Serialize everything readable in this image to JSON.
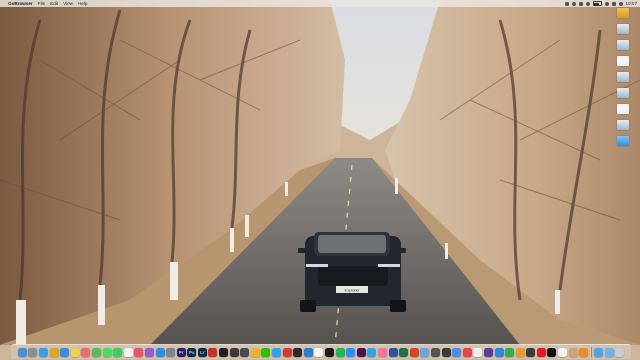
{
  "menubar": {
    "app_name": "GoBrowser",
    "menus": [
      "File",
      "Edit",
      "View",
      "Help"
    ],
    "clock": "10:07"
  },
  "desktop_icons": [
    {
      "name": "folder",
      "icon": "folder-icon",
      "label": ""
    },
    {
      "name": "screenshot",
      "icon": "screenshot-icon",
      "label": ""
    },
    {
      "name": "screenshot-2",
      "icon": "screenshot-icon",
      "label": ""
    },
    {
      "name": "document",
      "icon": "document-icon",
      "label": ""
    },
    {
      "name": "screenshot-3",
      "icon": "screenshot-icon",
      "label": ""
    },
    {
      "name": "screenshot-4",
      "icon": "screenshot-icon",
      "label": ""
    },
    {
      "name": "document-2",
      "icon": "document-icon",
      "label": ""
    },
    {
      "name": "screenshot-5",
      "icon": "screenshot-icon",
      "label": ""
    },
    {
      "name": "folder-blue",
      "icon": "folder-blue-icon",
      "label": ""
    }
  ],
  "dock": {
    "items": [
      {
        "name": "finder",
        "color": "#4a90d9",
        "glyph": ""
      },
      {
        "name": "launchpad",
        "color": "#8a8f98",
        "glyph": ""
      },
      {
        "name": "safari",
        "color": "#3aa0e8",
        "glyph": ""
      },
      {
        "name": "chrome",
        "color": "#e2a422",
        "glyph": ""
      },
      {
        "name": "mail",
        "color": "#3b8be0",
        "glyph": ""
      },
      {
        "name": "notes",
        "color": "#f2d04a",
        "glyph": ""
      },
      {
        "name": "photos",
        "color": "#e96d6d",
        "glyph": ""
      },
      {
        "name": "maps",
        "color": "#5bb85d",
        "glyph": ""
      },
      {
        "name": "messages",
        "color": "#4cd964",
        "glyph": ""
      },
      {
        "name": "facetime",
        "color": "#3ccf5b",
        "glyph": ""
      },
      {
        "name": "calendar",
        "color": "#f4f4f4",
        "glyph": ""
      },
      {
        "name": "music",
        "color": "#f0506e",
        "glyph": ""
      },
      {
        "name": "podcasts",
        "color": "#9b59d0",
        "glyph": ""
      },
      {
        "name": "app-store",
        "color": "#2f8ee8",
        "glyph": ""
      },
      {
        "name": "system-settings",
        "color": "#7d8691",
        "glyph": ""
      },
      {
        "name": "premiere",
        "color": "#2a1f5c",
        "glyph": "Pr"
      },
      {
        "name": "photoshop",
        "color": "#0c2b48",
        "glyph": "Ps"
      },
      {
        "name": "lightroom",
        "color": "#0f2a44",
        "glyph": "Lr"
      },
      {
        "name": "acrobat",
        "color": "#c8302a",
        "glyph": ""
      },
      {
        "name": "terminal",
        "color": "#1f1f1f",
        "glyph": ""
      },
      {
        "name": "final-cut",
        "color": "#3a3a3a",
        "glyph": ""
      },
      {
        "name": "davinci",
        "color": "#4a4a55",
        "glyph": ""
      },
      {
        "name": "sketch",
        "color": "#f5b02a",
        "glyph": ""
      },
      {
        "name": "wechat",
        "color": "#2dc100",
        "glyph": ""
      },
      {
        "name": "qq",
        "color": "#2aa4f4",
        "glyph": ""
      },
      {
        "name": "netease-music",
        "color": "#d33a31",
        "glyph": ""
      },
      {
        "name": "obs",
        "color": "#2b2b2b",
        "glyph": ""
      },
      {
        "name": "vscode",
        "color": "#2a7fd4",
        "glyph": ""
      },
      {
        "name": "notion",
        "color": "#f7f7f7",
        "glyph": ""
      },
      {
        "name": "figma",
        "color": "#1e1e1e",
        "glyph": ""
      },
      {
        "name": "spotify",
        "color": "#1db954",
        "glyph": ""
      },
      {
        "name": "zoom",
        "color": "#2d8cff",
        "glyph": ""
      },
      {
        "name": "slack",
        "color": "#4a154b",
        "glyph": ""
      },
      {
        "name": "telegram",
        "color": "#2ca5e0",
        "glyph": ""
      },
      {
        "name": "bilibili",
        "color": "#fb7299",
        "glyph": ""
      },
      {
        "name": "word",
        "color": "#2b579a",
        "glyph": ""
      },
      {
        "name": "excel",
        "color": "#217346",
        "glyph": ""
      },
      {
        "name": "powerpoint",
        "color": "#d24726",
        "glyph": ""
      },
      {
        "name": "preview",
        "color": "#6aa8e0",
        "glyph": ""
      },
      {
        "name": "calculator",
        "color": "#555555",
        "glyph": ""
      },
      {
        "name": "activity-monitor",
        "color": "#3a3a3a",
        "glyph": ""
      },
      {
        "name": "baidu-netdisk",
        "color": "#4a8ef0",
        "glyph": ""
      },
      {
        "name": "xmind",
        "color": "#e8424a",
        "glyph": ""
      },
      {
        "name": "typora",
        "color": "#efefef",
        "glyph": ""
      },
      {
        "name": "iina",
        "color": "#5a3f9e",
        "glyph": ""
      },
      {
        "name": "keynote",
        "color": "#2d88e0",
        "glyph": ""
      },
      {
        "name": "numbers",
        "color": "#30b04b",
        "glyph": ""
      },
      {
        "name": "pages",
        "color": "#f09a2a",
        "glyph": ""
      },
      {
        "name": "quicktime",
        "color": "#3b3b3b",
        "glyph": ""
      },
      {
        "name": "weibo",
        "color": "#e6162d",
        "glyph": ""
      },
      {
        "name": "douyin",
        "color": "#111111",
        "glyph": ""
      },
      {
        "name": "reminders",
        "color": "#f2f2f2",
        "glyph": ""
      },
      {
        "name": "contacts",
        "color": "#c9a577",
        "glyph": ""
      },
      {
        "name": "books",
        "color": "#f08a24",
        "glyph": ""
      }
    ],
    "trailing": [
      {
        "name": "downloads-folder",
        "color": "#4fa3e8",
        "glyph": ""
      },
      {
        "name": "documents-folder",
        "color": "#6cb4ee",
        "glyph": ""
      },
      {
        "name": "trash",
        "color": "#c9cdd2",
        "glyph": ""
      }
    ]
  },
  "wallpaper": {
    "license_plate": "Explorer"
  }
}
